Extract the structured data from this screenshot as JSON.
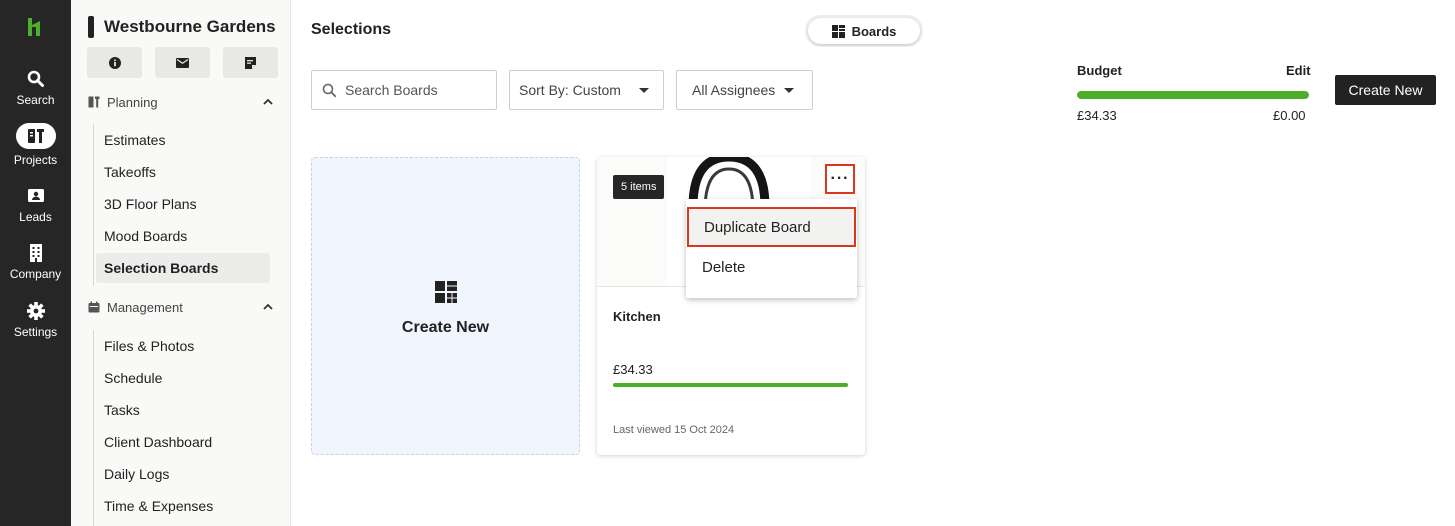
{
  "rail": {
    "items": [
      {
        "label": "Search",
        "icon": "search-icon"
      },
      {
        "label": "Projects",
        "icon": "projects-icon",
        "active": true
      },
      {
        "label": "Leads",
        "icon": "leads-icon"
      },
      {
        "label": "Company",
        "icon": "building-icon"
      },
      {
        "label": "Settings",
        "icon": "gear-icon"
      }
    ]
  },
  "side": {
    "project_title": "Westbourne Gardens",
    "quick_actions": [
      "info-icon",
      "mail-icon",
      "note-icon"
    ],
    "planning": {
      "label": "Planning",
      "items": [
        "Estimates",
        "Takeoffs",
        "3D Floor Plans",
        "Mood Boards",
        "Selection Boards"
      ]
    },
    "management": {
      "label": "Management",
      "items": [
        "Files & Photos",
        "Schedule",
        "Tasks",
        "Client Dashboard",
        "Daily Logs",
        "Time & Expenses"
      ]
    },
    "active_item": "Selection Boards"
  },
  "main": {
    "title": "Selections",
    "view_toggle": "Boards",
    "search": {
      "placeholder": "Search Boards",
      "value": ""
    },
    "sort": "Sort By: Custom",
    "assignees": "All Assignees",
    "budget": {
      "label": "Budget",
      "edit": "Edit",
      "spent": "£34.33",
      "remaining": "£0.00",
      "progress": 1.0
    },
    "create_button": "Create New",
    "create_card": "Create New",
    "boards": [
      {
        "items_badge": "5 items",
        "name": "Kitchen",
        "cost": "£34.33",
        "progress": 1.0,
        "last_viewed": "Last viewed 15 Oct 2024"
      }
    ],
    "context_menu": [
      "Duplicate Board",
      "Delete"
    ]
  },
  "colors": {
    "rail_bg": "#262626",
    "accent_green": "#4caf28",
    "highlight_red": "#d9381e"
  }
}
